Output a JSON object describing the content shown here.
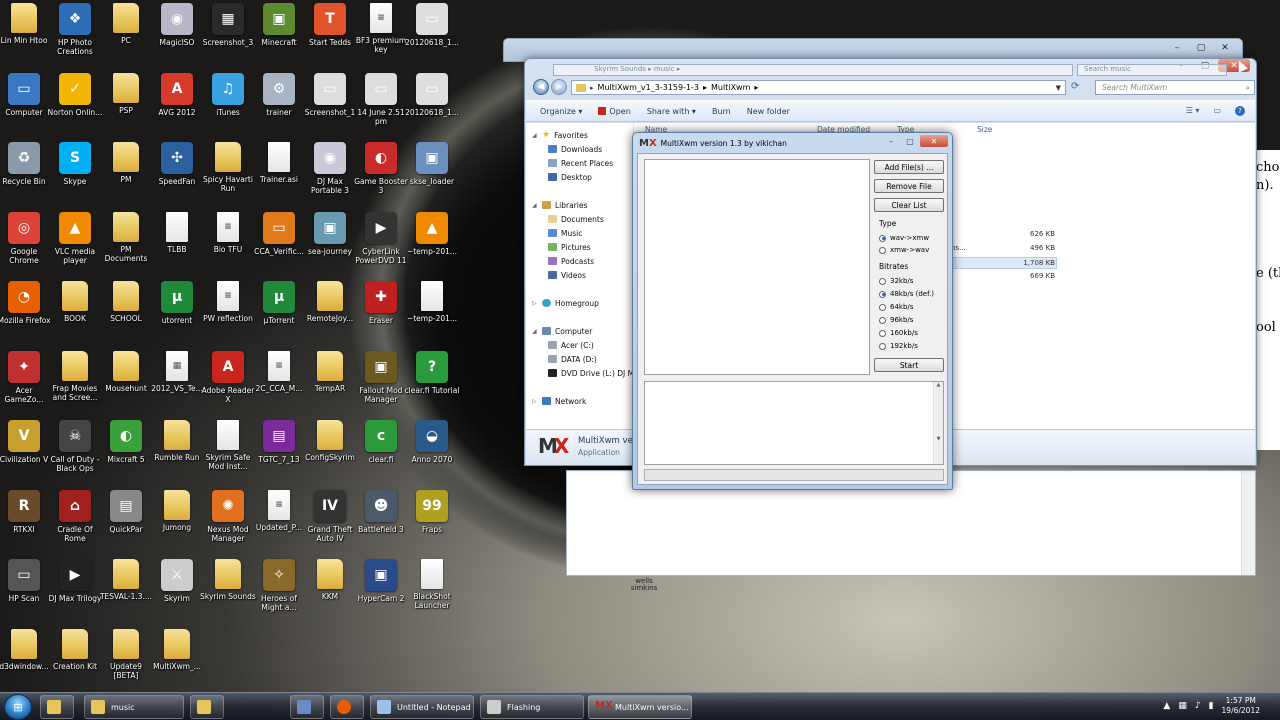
{
  "desktop": {
    "icons": [
      {
        "label": "Lin Min Htoo",
        "kind": "folder",
        "color": "#e8c55c",
        "glyph": ""
      },
      {
        "label": "HP Photo Creations",
        "kind": "app",
        "color": "#2c6fb7",
        "glyph": "❖"
      },
      {
        "label": "PC",
        "kind": "folder",
        "color": "#e8c55c",
        "glyph": ""
      },
      {
        "label": "MagicISO",
        "kind": "app",
        "color": "#b7b7c7",
        "glyph": "◉"
      },
      {
        "label": "Screenshot_3",
        "kind": "app",
        "color": "#2a2a2a",
        "glyph": "▦"
      },
      {
        "label": "Minecraft",
        "kind": "app",
        "color": "#5b8a2f",
        "glyph": "▣"
      },
      {
        "label": "Start Tedds",
        "kind": "app",
        "color": "#e0532b",
        "glyph": "T"
      },
      {
        "label": "BF3 premium key",
        "kind": "doc",
        "color": "#ffffff",
        "glyph": "≡"
      },
      {
        "label": "20120618_1...",
        "kind": "app",
        "color": "#dddddd",
        "glyph": "▭"
      },
      {
        "label": "Computer",
        "kind": "app",
        "color": "#3b78c4",
        "glyph": "▭"
      },
      {
        "label": "Norton Onlin...",
        "kind": "app",
        "color": "#f2b705",
        "glyph": "✓"
      },
      {
        "label": "PSP",
        "kind": "folder",
        "color": "#e8c55c",
        "glyph": ""
      },
      {
        "label": "AVG 2012",
        "kind": "app",
        "color": "#d63a2a",
        "glyph": "A"
      },
      {
        "label": "iTunes",
        "kind": "app",
        "color": "#3aa0e0",
        "glyph": "♫"
      },
      {
        "label": "trainer",
        "kind": "app",
        "color": "#a8b4c4",
        "glyph": "⚙"
      },
      {
        "label": "Screenshot_1",
        "kind": "app",
        "color": "#dddddd",
        "glyph": "▭"
      },
      {
        "label": "14 June 2.51 pm",
        "kind": "app",
        "color": "#dddddd",
        "glyph": "▭"
      },
      {
        "label": "20120618_1...",
        "kind": "app",
        "color": "#dddddd",
        "glyph": "▭"
      },
      {
        "label": "Recycle Bin",
        "kind": "app",
        "color": "#8a9aaa",
        "glyph": "♻"
      },
      {
        "label": "Skype",
        "kind": "app",
        "color": "#00aff0",
        "glyph": "S"
      },
      {
        "label": "PM",
        "kind": "folder",
        "color": "#e8c55c",
        "glyph": ""
      },
      {
        "label": "SpeedFan",
        "kind": "app",
        "color": "#2b5fa0",
        "glyph": "✣"
      },
      {
        "label": "Spicy Havarti Run",
        "kind": "folder",
        "color": "#e8c55c",
        "glyph": ""
      },
      {
        "label": "Trainer.asi",
        "kind": "doc",
        "color": "#ffffff",
        "glyph": ""
      },
      {
        "label": "DJ Max Portable 3",
        "kind": "app",
        "color": "#c9c9d9",
        "glyph": "◉"
      },
      {
        "label": "Game Booster 3",
        "kind": "app",
        "color": "#c92a2a",
        "glyph": "◐"
      },
      {
        "label": "skse_loader",
        "kind": "app",
        "color": "#6b8fbf",
        "glyph": "▣"
      },
      {
        "label": "Google Chrome",
        "kind": "app",
        "color": "#db4437",
        "glyph": "◎"
      },
      {
        "label": "VLC media player",
        "kind": "app",
        "color": "#f08a00",
        "glyph": "▲"
      },
      {
        "label": "PM Documents",
        "kind": "folder",
        "color": "#e8c55c",
        "glyph": ""
      },
      {
        "label": "TLBB",
        "kind": "doc",
        "color": "#ffffff",
        "glyph": ""
      },
      {
        "label": "Bio TFU",
        "kind": "doc",
        "color": "#ffffff",
        "glyph": "≡"
      },
      {
        "label": "CCA_Verific...",
        "kind": "app",
        "color": "#e07a1a",
        "glyph": "▭"
      },
      {
        "label": "sea-journey",
        "kind": "app",
        "color": "#6a9ab0",
        "glyph": "▣"
      },
      {
        "label": "CyberLink PowerDVD 11",
        "kind": "app",
        "color": "#333333",
        "glyph": "▶"
      },
      {
        "label": "~temp-201...",
        "kind": "app",
        "color": "#f08a00",
        "glyph": "▲"
      },
      {
        "label": "Mozilla Firefox",
        "kind": "app",
        "color": "#e66000",
        "glyph": "◔"
      },
      {
        "label": "BOOK",
        "kind": "folder",
        "color": "#e8c55c",
        "glyph": ""
      },
      {
        "label": "SCHOOL",
        "kind": "folder",
        "color": "#e8c55c",
        "glyph": ""
      },
      {
        "label": "utorrent",
        "kind": "app",
        "color": "#1f8a3a",
        "glyph": "µ"
      },
      {
        "label": "PW reflection",
        "kind": "doc",
        "color": "#ffffff",
        "glyph": "≡"
      },
      {
        "label": "µTorrent",
        "kind": "app",
        "color": "#1f8a3a",
        "glyph": "µ"
      },
      {
        "label": "RemoteJoy...",
        "kind": "folder",
        "color": "#e8c55c",
        "glyph": ""
      },
      {
        "label": "Eraser",
        "kind": "app",
        "color": "#c02020",
        "glyph": "✚"
      },
      {
        "label": "~temp-201...",
        "kind": "doc",
        "color": "#ffffff",
        "glyph": ""
      },
      {
        "label": "Acer GameZo...",
        "kind": "app",
        "color": "#c03030",
        "glyph": "✦"
      },
      {
        "label": "Frap Movies and Scree...",
        "kind": "folder",
        "color": "#e8c55c",
        "glyph": ""
      },
      {
        "label": "Mousehunt",
        "kind": "folder",
        "color": "#e8c55c",
        "glyph": ""
      },
      {
        "label": "2012_VS_Te...",
        "kind": "doc",
        "color": "#ffffff",
        "glyph": "▦"
      },
      {
        "label": "Adobe Reader X",
        "kind": "app",
        "color": "#c8261d",
        "glyph": "A"
      },
      {
        "label": "2C_CCA_M...",
        "kind": "doc",
        "color": "#ffffff",
        "glyph": "≡"
      },
      {
        "label": "TempAR",
        "kind": "folder",
        "color": "#e8c55c",
        "glyph": ""
      },
      {
        "label": "Fallout Mod Manager",
        "kind": "app",
        "color": "#6a5a20",
        "glyph": "▣"
      },
      {
        "label": "clear.fi Tutorial",
        "kind": "app",
        "color": "#2a9a3a",
        "glyph": "?"
      },
      {
        "label": "Civilization V",
        "kind": "app",
        "color": "#c8a030",
        "glyph": "V"
      },
      {
        "label": "Call of Duty - Black Ops",
        "kind": "app",
        "color": "#444444",
        "glyph": "☠"
      },
      {
        "label": "Mixcraft 5",
        "kind": "app",
        "color": "#3aa03a",
        "glyph": "◐"
      },
      {
        "label": "Rumble Run",
        "kind": "folder",
        "color": "#e8c55c",
        "glyph": ""
      },
      {
        "label": "Skyrim Safe Mod Inst...",
        "kind": "doc",
        "color": "#ffffff",
        "glyph": ""
      },
      {
        "label": "TGTC_7_13",
        "kind": "app",
        "color": "#7a2a9a",
        "glyph": "▤"
      },
      {
        "label": "ConfigSkyrim",
        "kind": "folder",
        "color": "#e8c55c",
        "glyph": ""
      },
      {
        "label": "clear.fi",
        "kind": "app",
        "color": "#2a9a3a",
        "glyph": "c"
      },
      {
        "label": "Anno 2070",
        "kind": "app",
        "color": "#2a5a8a",
        "glyph": "◒"
      },
      {
        "label": "RTKXI",
        "kind": "app",
        "color": "#6a4a2a",
        "glyph": "R"
      },
      {
        "label": "Cradle Of Rome",
        "kind": "app",
        "color": "#a02020",
        "glyph": "⌂"
      },
      {
        "label": "QuickPar",
        "kind": "app",
        "color": "#888888",
        "glyph": "▤"
      },
      {
        "label": "Jumong",
        "kind": "folder",
        "color": "#e8c55c",
        "glyph": ""
      },
      {
        "label": "Nexus Mod Manager",
        "kind": "app",
        "color": "#e07020",
        "glyph": "✺"
      },
      {
        "label": "Updated_P...",
        "kind": "doc",
        "color": "#ffffff",
        "glyph": "≡"
      },
      {
        "label": "Grand Theft Auto IV",
        "kind": "app",
        "color": "#333333",
        "glyph": "IV"
      },
      {
        "label": "Battlefield 3",
        "kind": "app",
        "color": "#4a5a6a",
        "glyph": "☻"
      },
      {
        "label": "Fraps",
        "kind": "app",
        "color": "#b0a020",
        "glyph": "99"
      },
      {
        "label": "HP Scan",
        "kind": "app",
        "color": "#555555",
        "glyph": "▭"
      },
      {
        "label": "DJ Max Trilogy",
        "kind": "app",
        "color": "#222222",
        "glyph": "▶"
      },
      {
        "label": "TESVAL-1.3....",
        "kind": "folder",
        "color": "#e8c55c",
        "glyph": ""
      },
      {
        "label": "Skyrim",
        "kind": "app",
        "color": "#cccccc",
        "glyph": "⚔"
      },
      {
        "label": "Skyrim Sounds",
        "kind": "folder",
        "color": "#e8c55c",
        "glyph": ""
      },
      {
        "label": "Heroes of Might a...",
        "kind": "app",
        "color": "#8a6a2a",
        "glyph": "✧"
      },
      {
        "label": "KKM",
        "kind": "folder",
        "color": "#e8c55c",
        "glyph": ""
      },
      {
        "label": "HyperCam 2",
        "kind": "app",
        "color": "#2a4a8a",
        "glyph": "▣"
      },
      {
        "label": "BlackShot Launcher",
        "kind": "doc",
        "color": "#ffffff",
        "glyph": ""
      },
      {
        "label": "d3dwindow...",
        "kind": "folder",
        "color": "#e8c55c",
        "glyph": ""
      },
      {
        "label": "Creation Kit",
        "kind": "folder",
        "color": "#e8c55c",
        "glyph": ""
      },
      {
        "label": "Update9 [BETA]",
        "kind": "folder",
        "color": "#e8c55c",
        "glyph": ""
      },
      {
        "label": "MultiXwm_...",
        "kind": "folder",
        "color": "#e8c55c",
        "glyph": ""
      }
    ]
  },
  "back_window": {
    "watermark": "wells simkins"
  },
  "word_peek": {
    "lines": [
      "choo",
      "n).",
      "e (th",
      "ool t"
    ]
  },
  "explorer": {
    "ghost_address": "Skyrim Sounds  ▸  music  ▸",
    "ghost_search": "Search music",
    "address": {
      "segments": [
        "MultiXwm_v1_3-3159-1-3",
        "▸",
        "MultiXwm",
        "▸"
      ]
    },
    "search_placeholder": "Search MultiXwm",
    "toolbar": {
      "organize": "Organize ▾",
      "open": "Open",
      "share_with": "Share with ▾",
      "burn": "Burn",
      "new_folder": "New folder"
    },
    "nav": {
      "favorites": "Favorites",
      "downloads": "Downloads",
      "recent_places": "Recent Places",
      "desktop": "Desktop",
      "libraries": "Libraries",
      "documents": "Documents",
      "music": "Music",
      "pictures": "Pictures",
      "podcasts": "Podcasts",
      "videos": "Videos",
      "homegroup": "Homegroup",
      "computer": "Computer",
      "acer": "Acer (C:)",
      "data": "DATA (D:)",
      "dvd": "DVD Drive (L:) DJ Ma",
      "network": "Network"
    },
    "columns": {
      "name": "Name",
      "date": "Date modified",
      "type": "Type",
      "size": "Size"
    },
    "file_sizes": [
      "626 KB",
      "496 KB",
      "1,708 KB",
      "669 KB"
    ],
    "type_fragments": [
      "ns..."
    ],
    "details": {
      "name": "MultiXwm versi",
      "type": "Application"
    }
  },
  "dialog": {
    "title": "MultiXwm version 1.3 by vikichan",
    "buttons": {
      "add": "Add File(s) ...",
      "remove": "Remove File",
      "clear": "Clear List",
      "start": "Start"
    },
    "type_label": "Type",
    "type_options": [
      {
        "label": "wav->xmw",
        "selected": true
      },
      {
        "label": "xmw->wav",
        "selected": false
      }
    ],
    "bitrates_label": "Bitrates",
    "bitrate_options": [
      {
        "label": "32kb/s",
        "selected": false
      },
      {
        "label": "48kb/s (def.)",
        "selected": true
      },
      {
        "label": "64kb/s",
        "selected": false
      },
      {
        "label": "96kb/s",
        "selected": false
      },
      {
        "label": "160kb/s",
        "selected": false
      },
      {
        "label": "192kb/s",
        "selected": false
      }
    ]
  },
  "taskbar": {
    "items": [
      {
        "label": "music",
        "color": "#e8c55c"
      },
      {
        "label": "",
        "color": "#e8c55c"
      },
      {
        "label": "",
        "color": "#6a8ac8"
      },
      {
        "label": "",
        "color": "#e66000"
      },
      {
        "label": "Untitled - Notepad",
        "color": "#9ac0e8"
      },
      {
        "label": "Flashing",
        "color": "#cccccc"
      },
      {
        "label": "MultiXwm versio...",
        "color": "#c8261d"
      }
    ],
    "time": "1:57 PM",
    "date": "19/6/2012"
  }
}
